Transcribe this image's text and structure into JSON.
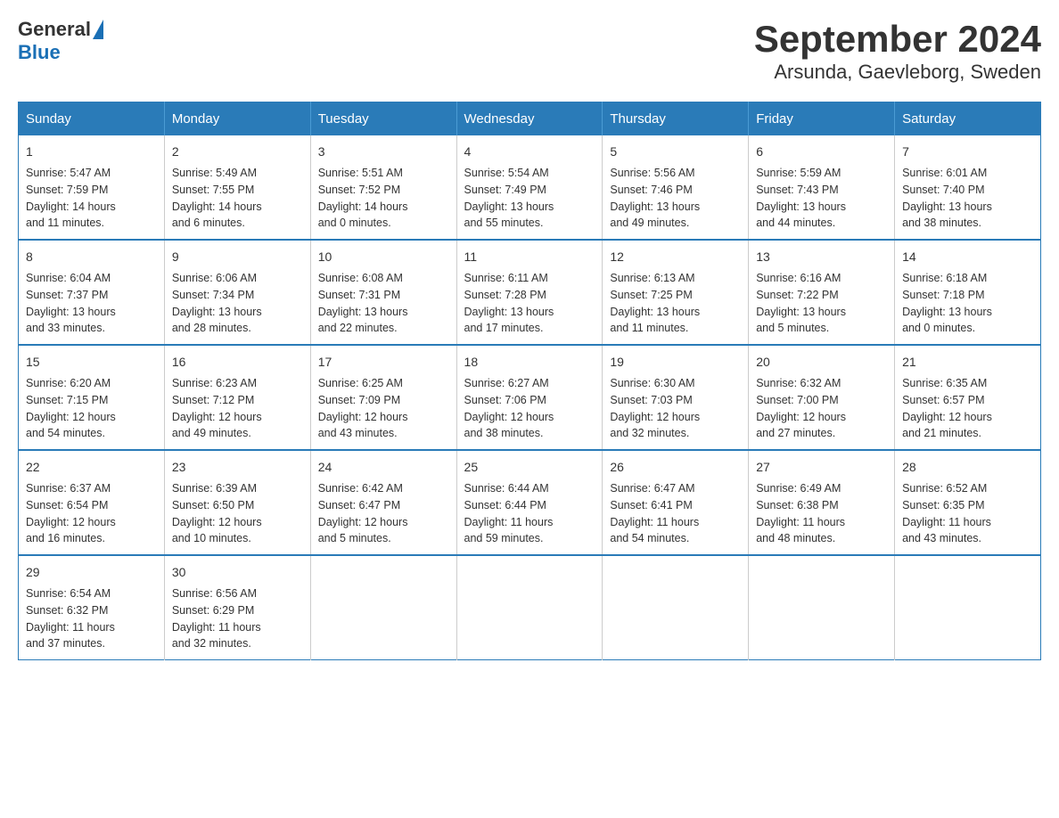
{
  "logo": {
    "text_general": "General",
    "text_blue": "Blue",
    "triangle_color": "#1a6fb5"
  },
  "title": {
    "month_year": "September 2024",
    "location": "Arsunda, Gaevleborg, Sweden"
  },
  "header_days": [
    "Sunday",
    "Monday",
    "Tuesday",
    "Wednesday",
    "Thursday",
    "Friday",
    "Saturday"
  ],
  "weeks": [
    [
      {
        "day": "1",
        "sunrise": "5:47 AM",
        "sunset": "7:59 PM",
        "daylight": "14 hours and 11 minutes."
      },
      {
        "day": "2",
        "sunrise": "5:49 AM",
        "sunset": "7:55 PM",
        "daylight": "14 hours and 6 minutes."
      },
      {
        "day": "3",
        "sunrise": "5:51 AM",
        "sunset": "7:52 PM",
        "daylight": "14 hours and 0 minutes."
      },
      {
        "day": "4",
        "sunrise": "5:54 AM",
        "sunset": "7:49 PM",
        "daylight": "13 hours and 55 minutes."
      },
      {
        "day": "5",
        "sunrise": "5:56 AM",
        "sunset": "7:46 PM",
        "daylight": "13 hours and 49 minutes."
      },
      {
        "day": "6",
        "sunrise": "5:59 AM",
        "sunset": "7:43 PM",
        "daylight": "13 hours and 44 minutes."
      },
      {
        "day": "7",
        "sunrise": "6:01 AM",
        "sunset": "7:40 PM",
        "daylight": "13 hours and 38 minutes."
      }
    ],
    [
      {
        "day": "8",
        "sunrise": "6:04 AM",
        "sunset": "7:37 PM",
        "daylight": "13 hours and 33 minutes."
      },
      {
        "day": "9",
        "sunrise": "6:06 AM",
        "sunset": "7:34 PM",
        "daylight": "13 hours and 28 minutes."
      },
      {
        "day": "10",
        "sunrise": "6:08 AM",
        "sunset": "7:31 PM",
        "daylight": "13 hours and 22 minutes."
      },
      {
        "day": "11",
        "sunrise": "6:11 AM",
        "sunset": "7:28 PM",
        "daylight": "13 hours and 17 minutes."
      },
      {
        "day": "12",
        "sunrise": "6:13 AM",
        "sunset": "7:25 PM",
        "daylight": "13 hours and 11 minutes."
      },
      {
        "day": "13",
        "sunrise": "6:16 AM",
        "sunset": "7:22 PM",
        "daylight": "13 hours and 5 minutes."
      },
      {
        "day": "14",
        "sunrise": "6:18 AM",
        "sunset": "7:18 PM",
        "daylight": "13 hours and 0 minutes."
      }
    ],
    [
      {
        "day": "15",
        "sunrise": "6:20 AM",
        "sunset": "7:15 PM",
        "daylight": "12 hours and 54 minutes."
      },
      {
        "day": "16",
        "sunrise": "6:23 AM",
        "sunset": "7:12 PM",
        "daylight": "12 hours and 49 minutes."
      },
      {
        "day": "17",
        "sunrise": "6:25 AM",
        "sunset": "7:09 PM",
        "daylight": "12 hours and 43 minutes."
      },
      {
        "day": "18",
        "sunrise": "6:27 AM",
        "sunset": "7:06 PM",
        "daylight": "12 hours and 38 minutes."
      },
      {
        "day": "19",
        "sunrise": "6:30 AM",
        "sunset": "7:03 PM",
        "daylight": "12 hours and 32 minutes."
      },
      {
        "day": "20",
        "sunrise": "6:32 AM",
        "sunset": "7:00 PM",
        "daylight": "12 hours and 27 minutes."
      },
      {
        "day": "21",
        "sunrise": "6:35 AM",
        "sunset": "6:57 PM",
        "daylight": "12 hours and 21 minutes."
      }
    ],
    [
      {
        "day": "22",
        "sunrise": "6:37 AM",
        "sunset": "6:54 PM",
        "daylight": "12 hours and 16 minutes."
      },
      {
        "day": "23",
        "sunrise": "6:39 AM",
        "sunset": "6:50 PM",
        "daylight": "12 hours and 10 minutes."
      },
      {
        "day": "24",
        "sunrise": "6:42 AM",
        "sunset": "6:47 PM",
        "daylight": "12 hours and 5 minutes."
      },
      {
        "day": "25",
        "sunrise": "6:44 AM",
        "sunset": "6:44 PM",
        "daylight": "11 hours and 59 minutes."
      },
      {
        "day": "26",
        "sunrise": "6:47 AM",
        "sunset": "6:41 PM",
        "daylight": "11 hours and 54 minutes."
      },
      {
        "day": "27",
        "sunrise": "6:49 AM",
        "sunset": "6:38 PM",
        "daylight": "11 hours and 48 minutes."
      },
      {
        "day": "28",
        "sunrise": "6:52 AM",
        "sunset": "6:35 PM",
        "daylight": "11 hours and 43 minutes."
      }
    ],
    [
      {
        "day": "29",
        "sunrise": "6:54 AM",
        "sunset": "6:32 PM",
        "daylight": "11 hours and 37 minutes."
      },
      {
        "day": "30",
        "sunrise": "6:56 AM",
        "sunset": "6:29 PM",
        "daylight": "11 hours and 32 minutes."
      },
      null,
      null,
      null,
      null,
      null
    ]
  ],
  "labels": {
    "sunrise": "Sunrise:",
    "sunset": "Sunset:",
    "daylight": "Daylight:"
  }
}
